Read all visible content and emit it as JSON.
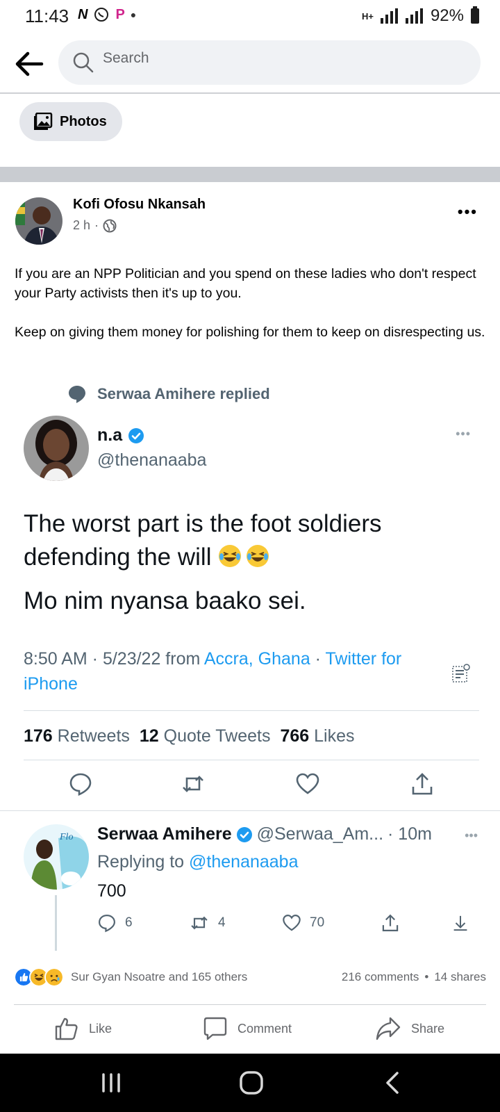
{
  "status_bar": {
    "time": "11:43",
    "app_icons": [
      "N",
      "P"
    ],
    "battery": "92%",
    "signal_indicator": "H+"
  },
  "search": {
    "placeholder": "Search"
  },
  "filter_chip": {
    "label": "Photos"
  },
  "post": {
    "author": "Kofi Ofosu Nkansah",
    "time": "2 h",
    "meta_separator": "·",
    "text_paragraphs": [
      "If you are an NPP Politician and you spend on these ladies who don't respect your Party activists then it's up to you.",
      "Keep on giving them money for polishing for them to keep on disrespecting us."
    ]
  },
  "tweet_screenshot": {
    "reply_indicator": "Serwaa Amihere replied",
    "tweet": {
      "display_name": "n.a",
      "handle": "@thenanaaba",
      "verified": true,
      "body_line1": "The worst part is the foot soldiers defending the will",
      "body_line2": "Mo nim nyansa baako sei.",
      "time": "8:50 AM · 5/23/22 from ",
      "location": "Accra, Ghana",
      "separator": " · ",
      "source": "Twitter for iPhone",
      "retweets_count": "176",
      "retweets_label": "Retweets",
      "quotes_count": "12",
      "quotes_label": "Quote Tweets",
      "likes_count": "766",
      "likes_label": "Likes"
    },
    "reply": {
      "display_name": "Serwaa Amihere",
      "handle": "@Serwaa_Am...",
      "time": "· 10m",
      "replying_prefix": "Replying to ",
      "replying_to": "@thenanaaba",
      "text": "700",
      "replies": "6",
      "retweets": "4",
      "likes": "70"
    }
  },
  "reactions": {
    "summary": "Sur Gyan Nsoatre and 165 others",
    "comments": "216 comments",
    "separator": "•",
    "shares": "14 shares"
  },
  "post_actions": {
    "like": "Like",
    "comment": "Comment",
    "share": "Share"
  },
  "colors": {
    "twitter_blue": "#1d9bf0",
    "fb_gray": "#65676b",
    "like_blue": "#1877f2"
  }
}
